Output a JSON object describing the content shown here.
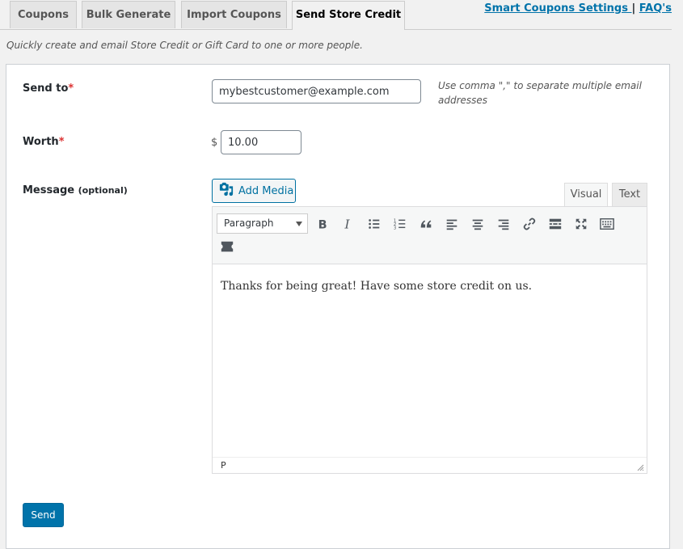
{
  "tabs": [
    {
      "label": "Coupons"
    },
    {
      "label": "Bulk Generate"
    },
    {
      "label": "Import Coupons"
    },
    {
      "label": "Send Store Credit",
      "active": true
    }
  ],
  "top_links": {
    "settings": "Smart Coupons Settings ",
    "separator": "|",
    "faq": "FAQ's"
  },
  "description": "Quickly create and email Store Credit or Gift Card to one or more people.",
  "form": {
    "send_to": {
      "label": "Send to",
      "required_mark": "*",
      "value": "mybestcustomer@example.com",
      "hint": "Use comma \",\" to separate multiple email addresses"
    },
    "worth": {
      "label": "Worth",
      "required_mark": "*",
      "currency": "$",
      "value": "10.00"
    },
    "message": {
      "label": "Message",
      "optional": "(optional)",
      "add_media": "Add Media",
      "mode_tabs": {
        "visual": "Visual",
        "text": "Text"
      },
      "format_select": "Paragraph",
      "toolbar_icons": [
        "bold-icon",
        "italic-icon",
        "bullet-list-icon",
        "numbered-list-icon",
        "blockquote-icon",
        "align-left-icon",
        "align-center-icon",
        "align-right-icon",
        "link-icon",
        "read-more-icon",
        "fullscreen-icon",
        "toolbar-toggle-icon",
        "coupon-icon"
      ],
      "content": "Thanks for being great! Have some store credit on us.",
      "status_path": "P"
    },
    "send_label": "Send"
  },
  "colors": {
    "accent": "#0073aa",
    "required": "#dc3232"
  }
}
